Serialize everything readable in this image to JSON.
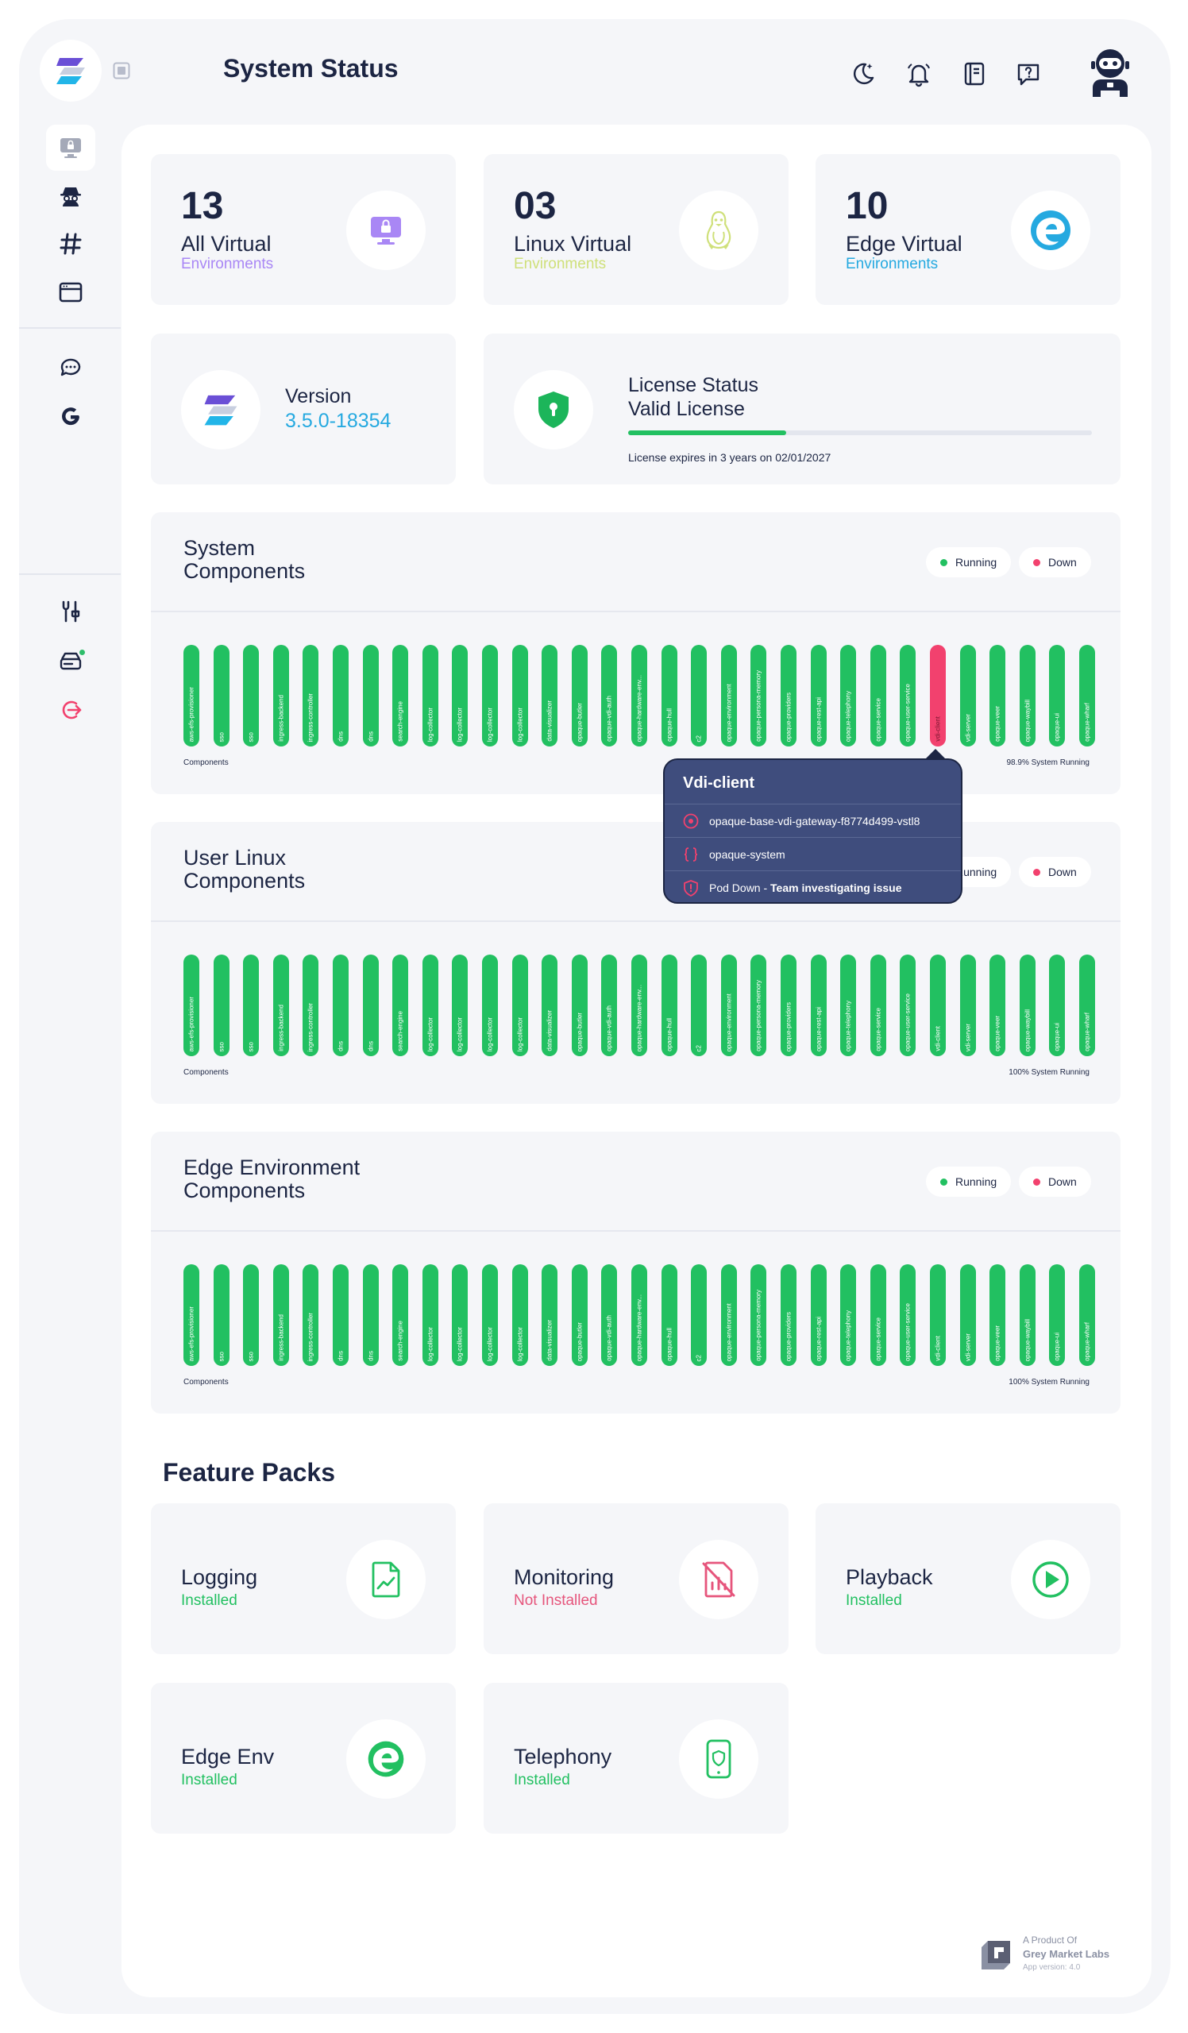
{
  "header": {
    "title": "System Status"
  },
  "colors": {
    "running": "#22c061",
    "down": "#f2416e",
    "purple": "#a987f5",
    "linux": "#cfe07a",
    "edge": "#25a9e0",
    "installed": "#22c061",
    "not_installed": "#e6557c"
  },
  "stats": [
    {
      "number": "13",
      "title": "All Virtual",
      "subtitle": "Environments",
      "icon": "monitor-lock-icon"
    },
    {
      "number": "03",
      "title": "Linux Virtual",
      "subtitle": "Environments",
      "icon": "linux-penguin-icon"
    },
    {
      "number": "10",
      "title": "Edge Virtual",
      "subtitle": "Environments",
      "icon": "edge-browser-icon"
    }
  ],
  "version": {
    "label": "Version",
    "value": "3.5.0-18354"
  },
  "license": {
    "title": "License Status",
    "status": "Valid License",
    "progress": 0.34,
    "note": "License expires in 3 years on 02/01/2027"
  },
  "legend": {
    "running": "Running",
    "down": "Down"
  },
  "component_names": [
    "aws-efs-provisioner",
    "sso",
    "sso",
    "ingress-backend",
    "ingress-controller",
    "dns",
    "dns",
    "search-engine",
    "log-collector",
    "log-collector",
    "log-collector",
    "log-collector",
    "data-visualizer",
    "opaque-butler",
    "opaque-vdi-auth",
    "opaque-hardware-env...",
    "opaque-hull",
    "c2",
    "opaque-environment",
    "opaque-persona-memory",
    "opaque-providers",
    "opaque-rest-api",
    "opaque-telephony",
    "opaque-service",
    "opaque-user-service",
    "vdi-client",
    "vdi-server",
    "opaque-veer",
    "opaque-waybill",
    "opaque-ui",
    "opaque-wharf"
  ],
  "components": [
    {
      "title_line1": "System",
      "title_line2": "Components",
      "footer_left": "Components",
      "footer_right": "98.9% System Running",
      "down_index": 25
    },
    {
      "title_line1": "User Linux",
      "title_line2": "Components",
      "footer_left": "Components",
      "footer_right": "100% System Running",
      "down_index": -1
    },
    {
      "title_line1": "Edge Environment",
      "title_line2": "Components",
      "footer_left": "Components",
      "footer_right": "100% System Running",
      "down_index": -1
    }
  ],
  "tooltip": {
    "title": "Vdi-client",
    "pod": "opaque-base-vdi-gateway-f8774d499-vstl8",
    "namespace": "opaque-system",
    "status_label": "Pod Down",
    "status_sep": " - ",
    "status_detail": "Team investigating issue"
  },
  "feature_packs": {
    "title": "Feature Packs",
    "items": [
      {
        "name": "Logging",
        "status": "Installed",
        "icon": "document-chart-icon"
      },
      {
        "name": "Monitoring",
        "status": "Not Installed",
        "icon": "monitoring-off-icon"
      },
      {
        "name": "Playback",
        "status": "Installed",
        "icon": "play-icon"
      },
      {
        "name": "Edge Env",
        "status": "Installed",
        "icon": "edge-env-icon"
      },
      {
        "name": "Telephony",
        "status": "Installed",
        "icon": "phone-shield-icon"
      }
    ]
  },
  "footer": {
    "line1": "A Product Of",
    "line2": "Grey Market Labs",
    "line3": "App version: 4.0"
  }
}
